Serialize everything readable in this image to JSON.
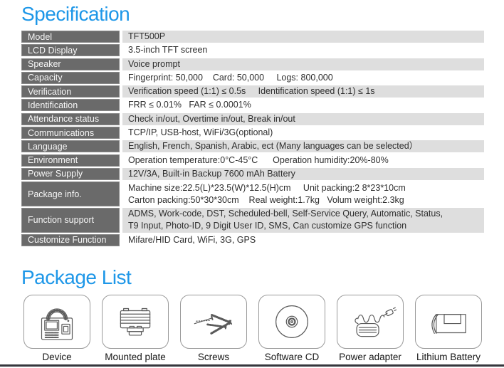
{
  "page": {
    "title_specification": "Specification",
    "title_package_list": "Package List"
  },
  "colors": {
    "accent_blue": "#1e97e8",
    "label_bg": "#6a6a6a",
    "row_alt_bg": "#dedede",
    "value_text": "#2e2e2e",
    "box_border": "#9a9a9a",
    "bottom_bar": "#35363c"
  },
  "spec": {
    "rows": [
      {
        "label": "Model",
        "lines": [
          "TFT500P"
        ]
      },
      {
        "label": "LCD Display",
        "lines": [
          "3.5-inch TFT screen"
        ]
      },
      {
        "label": "Speaker",
        "lines": [
          "Voice prompt"
        ]
      },
      {
        "label": "Capacity",
        "lines": [
          "Fingerprint: 50,000    Card: 50,000     Logs: 800,000"
        ]
      },
      {
        "label": "Verification",
        "lines": [
          "Verification speed (1:1) ≤ 0.5s     Identification speed (1:1) ≤ 1s"
        ]
      },
      {
        "label": "Identification",
        "lines": [
          "FRR ≤ 0.01%   FAR ≤ 0.0001%"
        ]
      },
      {
        "label": "Attendance status",
        "lines": [
          "Check in/out, Overtime in/out, Break in/out"
        ]
      },
      {
        "label": "Communications",
        "lines": [
          "TCP/IP, USB-host, WiFi/3G(optional)"
        ]
      },
      {
        "label": "Language",
        "lines": [
          "English, French, Spanish, Arabic, ect (Many languages can be selected）"
        ]
      },
      {
        "label": "Environment",
        "lines": [
          "Operation temperature:0°C-45°C      Operation humidity:20%-80%"
        ]
      },
      {
        "label": "Power Supply",
        "lines": [
          "12V/3A, Built-in Backup 7600 mAh Battery"
        ]
      },
      {
        "label": "Package info.",
        "lines": [
          "Machine size:22.5(L)*23.5(W)*12.5(H)cm     Unit packing:2 8*23*10cm",
          "Carton packing:50*30*30cm    Real weight:1.7kg   Volum weight:2.3kg"
        ]
      },
      {
        "label": "Function support",
        "lines": [
          "ADMS, Work-code, DST, Scheduled-bell, Self-Service Query, Automatic, Status,",
          "T9 Input, Photo-ID, 9 Digit User ID, SMS, Can customize GPS function"
        ]
      },
      {
        "label": "Customize Function",
        "lines": [
          "Mifare/HID Card, WiFi, 3G, GPS"
        ]
      }
    ]
  },
  "package_list": {
    "items": [
      {
        "label": "Device",
        "icon": "device-icon"
      },
      {
        "label": "Mounted plate",
        "icon": "mounted-plate-icon"
      },
      {
        "label": "Screws",
        "icon": "screws-icon"
      },
      {
        "label": "Software CD",
        "icon": "software-cd-icon"
      },
      {
        "label": "Power adapter",
        "icon": "power-adapter-icon"
      },
      {
        "label": "Lithium Battery",
        "icon": "lithium-battery-icon"
      }
    ]
  }
}
